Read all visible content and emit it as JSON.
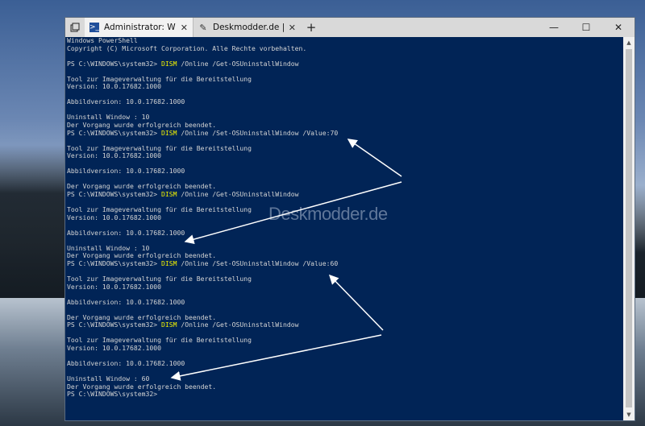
{
  "titlebar": {
    "tabs": [
      {
        "label": "Administrator: Window",
        "icon": "powershell-icon",
        "active": true,
        "close": "✕"
      },
      {
        "label": "Deskmodder.de | News, Tip",
        "icon": "web-page-icon",
        "active": false,
        "close": "✕"
      }
    ],
    "new_tab": "+",
    "controls": {
      "minimize": "—",
      "maximize": "☐",
      "close": "✕"
    }
  },
  "console": {
    "lines": [
      {
        "text": "Windows PowerShell"
      },
      {
        "text": "Copyright (C) Microsoft Corporation. Alle Rechte vorbehalten."
      },
      {
        "text": ""
      },
      {
        "prompt": "PS C:\\WINDOWS\\system32> ",
        "cmd": "DISM",
        "args": " /Online /Get-OSUninstallWindow"
      },
      {
        "text": ""
      },
      {
        "text": "Tool zur Imageverwaltung für die Bereitstellung"
      },
      {
        "text": "Version: 10.0.17682.1000"
      },
      {
        "text": ""
      },
      {
        "text": "Abbildversion: 10.0.17682.1000"
      },
      {
        "text": ""
      },
      {
        "text": "Uninstall Window : 10"
      },
      {
        "text": "Der Vorgang wurde erfolgreich beendet."
      },
      {
        "prompt": "PS C:\\WINDOWS\\system32> ",
        "cmd": "DISM",
        "args": " /Online /Set-OSUninstallWindow /Value:70"
      },
      {
        "text": ""
      },
      {
        "text": "Tool zur Imageverwaltung für die Bereitstellung"
      },
      {
        "text": "Version: 10.0.17682.1000"
      },
      {
        "text": ""
      },
      {
        "text": "Abbildversion: 10.0.17682.1000"
      },
      {
        "text": ""
      },
      {
        "text": "Der Vorgang wurde erfolgreich beendet."
      },
      {
        "prompt": "PS C:\\WINDOWS\\system32> ",
        "cmd": "DISM",
        "args": " /Online /Get-OSUninstallWindow"
      },
      {
        "text": ""
      },
      {
        "text": "Tool zur Imageverwaltung für die Bereitstellung"
      },
      {
        "text": "Version: 10.0.17682.1000"
      },
      {
        "text": ""
      },
      {
        "text": "Abbildversion: 10.0.17682.1000"
      },
      {
        "text": ""
      },
      {
        "text": "Uninstall Window : 10"
      },
      {
        "text": "Der Vorgang wurde erfolgreich beendet."
      },
      {
        "prompt": "PS C:\\WINDOWS\\system32> ",
        "cmd": "DISM",
        "args": " /Online /Set-OSUninstallWindow /Value:60"
      },
      {
        "text": ""
      },
      {
        "text": "Tool zur Imageverwaltung für die Bereitstellung"
      },
      {
        "text": "Version: 10.0.17682.1000"
      },
      {
        "text": ""
      },
      {
        "text": "Abbildversion: 10.0.17682.1000"
      },
      {
        "text": ""
      },
      {
        "text": "Der Vorgang wurde erfolgreich beendet."
      },
      {
        "prompt": "PS C:\\WINDOWS\\system32> ",
        "cmd": "DISM",
        "args": " /Online /Get-OSUninstallWindow"
      },
      {
        "text": ""
      },
      {
        "text": "Tool zur Imageverwaltung für die Bereitstellung"
      },
      {
        "text": "Version: 10.0.17682.1000"
      },
      {
        "text": ""
      },
      {
        "text": "Abbildversion: 10.0.17682.1000"
      },
      {
        "text": ""
      },
      {
        "text": "Uninstall Window : 60"
      },
      {
        "text": "Der Vorgang wurde erfolgreich beendet."
      },
      {
        "prompt": "PS C:\\WINDOWS\\system32>",
        "cmd": "",
        "args": ""
      }
    ]
  },
  "watermark": "Deskmodder.de",
  "colors": {
    "console_bg": "#012456",
    "console_text": "#d4d4d4",
    "command_highlight": "#f2f200"
  }
}
